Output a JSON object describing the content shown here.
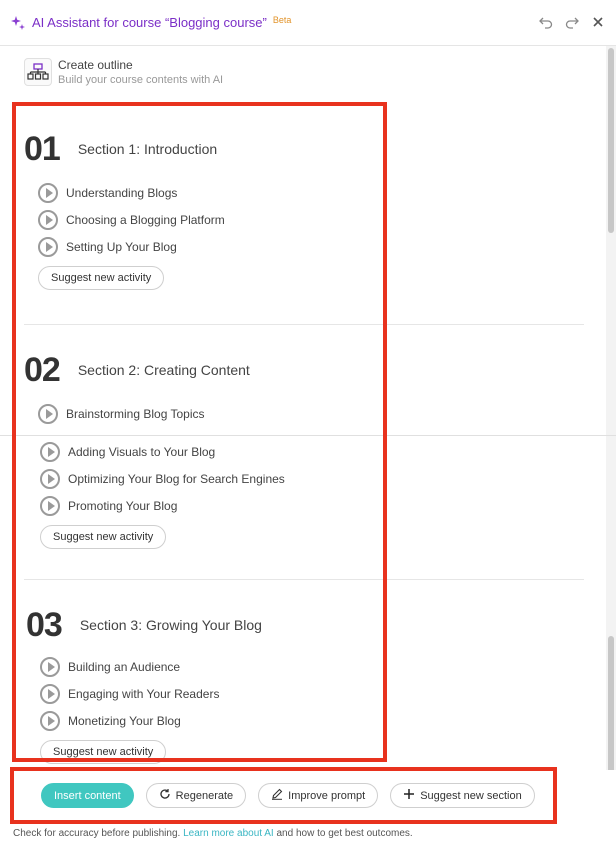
{
  "header": {
    "title": "AI Assistant for course “Blogging course”",
    "beta": "Beta",
    "undo_icon": "undo-icon",
    "redo_icon": "redo-icon",
    "close_icon": "close-icon"
  },
  "outline": {
    "title": "Create outline",
    "subtitle": "Build your course contents with AI"
  },
  "sections": [
    {
      "number": "01",
      "title": "Section 1: Introduction",
      "activities": [
        "Understanding Blogs",
        "Choosing a Blogging Platform",
        "Setting Up Your Blog"
      ],
      "suggest_label": "Suggest new activity"
    },
    {
      "number": "02",
      "title": "Section 2: Creating Content",
      "activities": [
        "Brainstorming Blog Topics",
        "Adding Visuals to Your Blog",
        "Optimizing Your Blog for Search Engines",
        "Promoting Your Blog"
      ],
      "suggest_label": "Suggest new activity"
    },
    {
      "number": "03",
      "title": "Section 3: Growing Your Blog",
      "activities": [
        "Building an Audience",
        "Engaging with Your Readers",
        "Monetizing Your Blog"
      ],
      "suggest_label": "Suggest new activity"
    }
  ],
  "footer": {
    "insert_label": "Insert content",
    "regenerate_label": "Regenerate",
    "improve_label": "Improve prompt",
    "suggest_section_label": "Suggest new section",
    "disclaimer_pre": "Check for accuracy before publishing.",
    "disclaimer_link": "Learn more about AI",
    "disclaimer_post": "and how to get best outcomes."
  },
  "colors": {
    "accent": "#7b2fc7",
    "primary_button": "#40c7c0",
    "highlight": "#e8321e",
    "beta": "#e2942b"
  }
}
